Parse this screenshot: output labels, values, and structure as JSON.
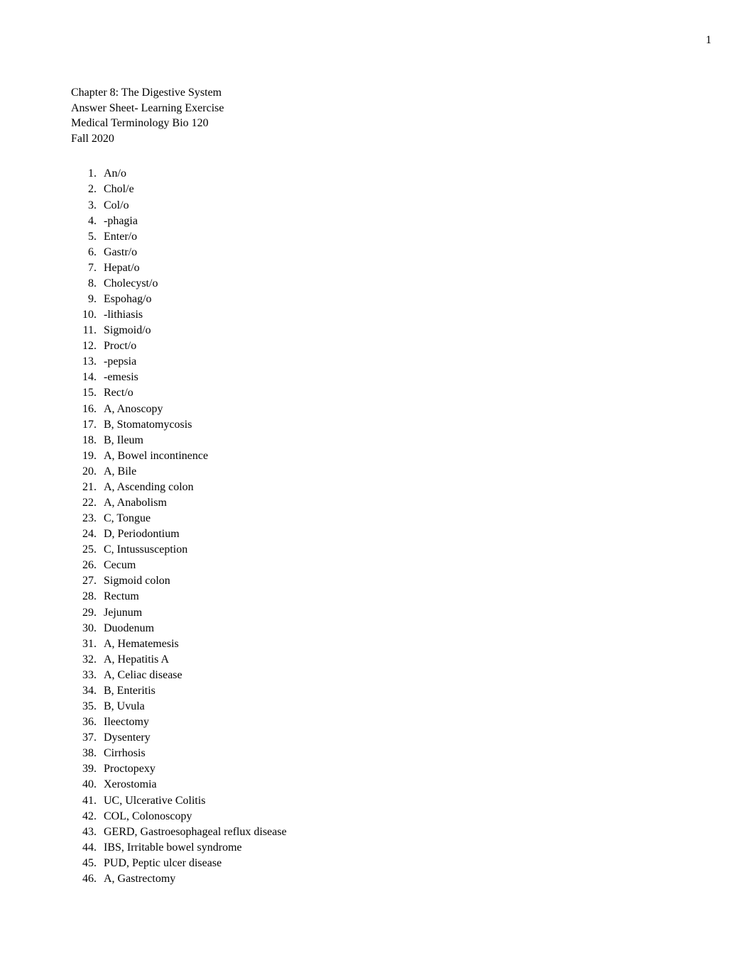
{
  "page_number": "1",
  "header": {
    "line1": "Chapter 8: The Digestive System",
    "line2": "Answer Sheet- Learning Exercise",
    "line3": "Medical Terminology Bio 120",
    "line4": "Fall 2020"
  },
  "answers": [
    "An/o",
    "Chol/e",
    "Col/o",
    "-phagia",
    "Enter/o",
    "Gastr/o",
    "Hepat/o",
    "Cholecyst/o",
    "Espohag/o",
    "-lithiasis",
    "Sigmoid/o",
    "Proct/o",
    "-pepsia",
    "-emesis",
    "Rect/o",
    "A, Anoscopy",
    "B, Stomatomycosis",
    "B, Ileum",
    "A, Bowel incontinence",
    "A, Bile",
    "A, Ascending colon",
    "A, Anabolism",
    "C, Tongue",
    "D, Periodontium",
    "C, Intussusception",
    "Cecum",
    "Sigmoid colon",
    "Rectum",
    "Jejunum",
    "Duodenum",
    "A, Hematemesis",
    "A, Hepatitis A",
    "A, Celiac disease",
    "B, Enteritis",
    "B, Uvula",
    "Ileectomy",
    "Dysentery",
    "Cirrhosis",
    "Proctopexy",
    "Xerostomia",
    "UC, Ulcerative Colitis",
    "COL, Colonoscopy",
    "GERD, Gastroesophageal reflux disease",
    "IBS, Irritable bowel syndrome",
    "PUD, Peptic ulcer disease",
    "A, Gastrectomy"
  ]
}
